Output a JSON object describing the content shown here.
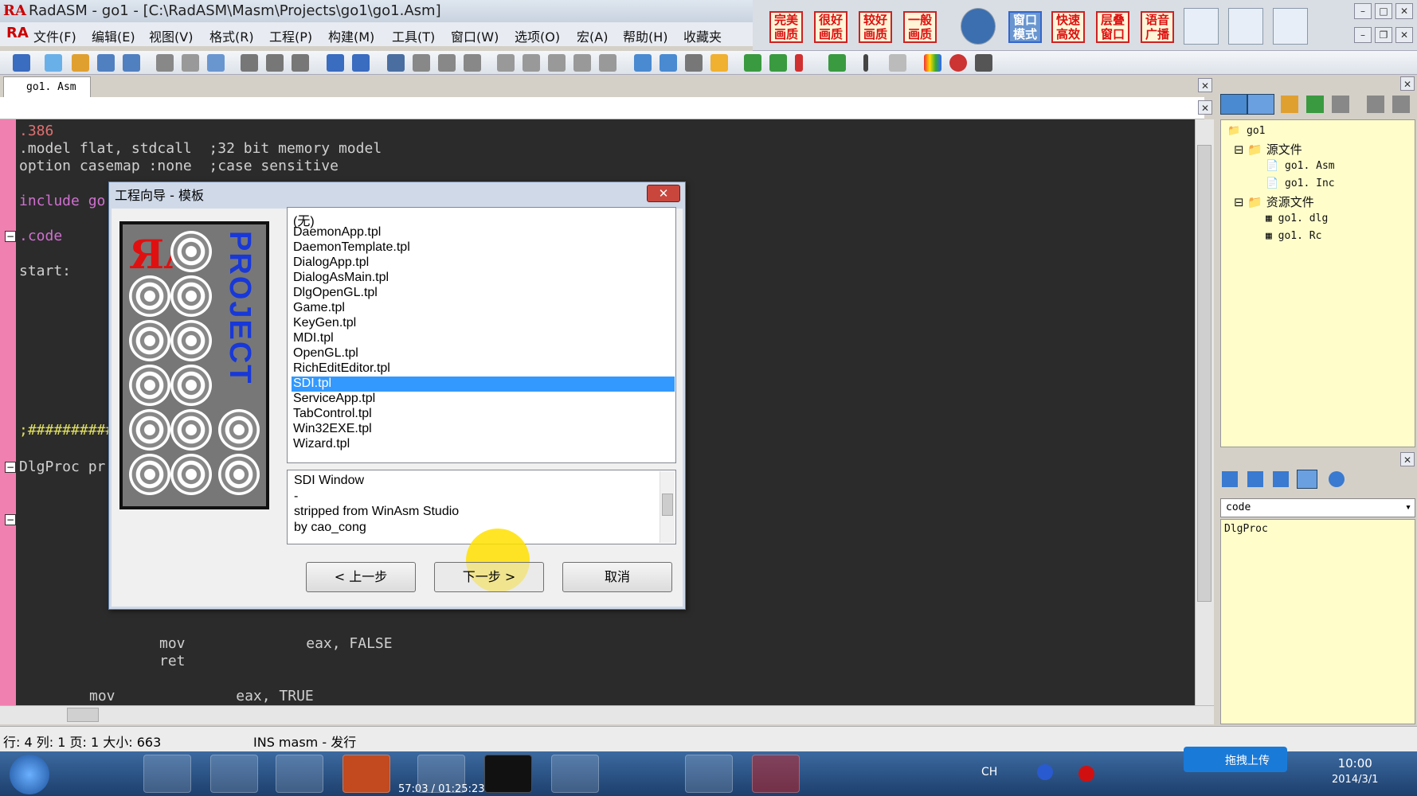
{
  "window": {
    "title": "RadASM - go1 - [C:\\RadASM\\Masm\\Projects\\go1\\go1.Asm]",
    "logo": "RA"
  },
  "menu": [
    "文件(F)",
    "编辑(E)",
    "视图(V)",
    "格式(R)",
    "工程(P)",
    "构建(M)",
    "工具(T)",
    "窗口(W)",
    "选项(O)",
    "宏(A)",
    "帮助(H)",
    "收藏夹"
  ],
  "quality_buttons": [
    "完美画质",
    "很好画质",
    "较好画质",
    "一般画质",
    "窗口模式",
    "快速高效",
    "层叠窗口",
    "语音广播"
  ],
  "tab": {
    "label": "go1. Asm"
  },
  "code_lines": [
    {
      "text": ".386",
      "color": "#e07070"
    },
    {
      "text": ".model flat, stdcall  ;32 bit memory model",
      "color": "#d0d0d0"
    },
    {
      "text": "option casemap :none  ;case sensitive",
      "color": "#d0d0d0"
    },
    {
      "text": "include go",
      "color": "#d070d0"
    },
    {
      "text": ".code",
      "color": "#d070d0"
    },
    {
      "text": "start:",
      "color": "#d0d0d0"
    },
    {
      "text": ";##########",
      "color": "#e0e060"
    },
    {
      "text": "DlgProc pr",
      "color": "#d0d0d0"
    },
    {
      "text": "mov              eax, FALSE",
      "color": "#d0d0d0"
    },
    {
      "text": "ret",
      "color": "#d0d0d0"
    },
    {
      "text": "mov              eax, TRUE",
      "color": "#d0d0d0"
    }
  ],
  "tree": {
    "root": "go1",
    "groups": [
      {
        "label": "源文件",
        "items": [
          "go1. Asm",
          "go1. Inc"
        ]
      },
      {
        "label": "资源文件",
        "items": [
          "go1. dlg",
          "go1. Rc"
        ]
      }
    ]
  },
  "combo": {
    "value": "code"
  },
  "props_list": [
    "DlgProc"
  ],
  "dialog": {
    "title": "工程向导 - 模板",
    "image_text": "PROJECT",
    "templates": [
      "(无)",
      "DaemonApp.tpl",
      "DaemonTemplate.tpl",
      "DialogApp.tpl",
      "DialogAsMain.tpl",
      "DlgOpenGL.tpl",
      "Game.tpl",
      "KeyGen.tpl",
      "MDI.tpl",
      "OpenGL.tpl",
      "RichEditEditor.tpl",
      "SDI.tpl",
      "ServiceApp.tpl",
      "TabControl.tpl",
      "Win32EXE.tpl",
      "Wizard.tpl"
    ],
    "selected_index": 11,
    "description": [
      "SDI Window",
      "-",
      "stripped from WinAsm Studio",
      "by cao_cong"
    ],
    "buttons": {
      "back": "< 上一步",
      "next": "下一步 >",
      "cancel": "取消"
    }
  },
  "status": {
    "position": "行: 4  列: 1 页: 1 大小: 663",
    "mode": "INS masm - 发行"
  },
  "taskbar": {
    "media_time": "57:03 / 01:25:23",
    "lang": "CH",
    "upload": "拖拽上传",
    "time": "10:00",
    "date": "2014/3/1"
  }
}
